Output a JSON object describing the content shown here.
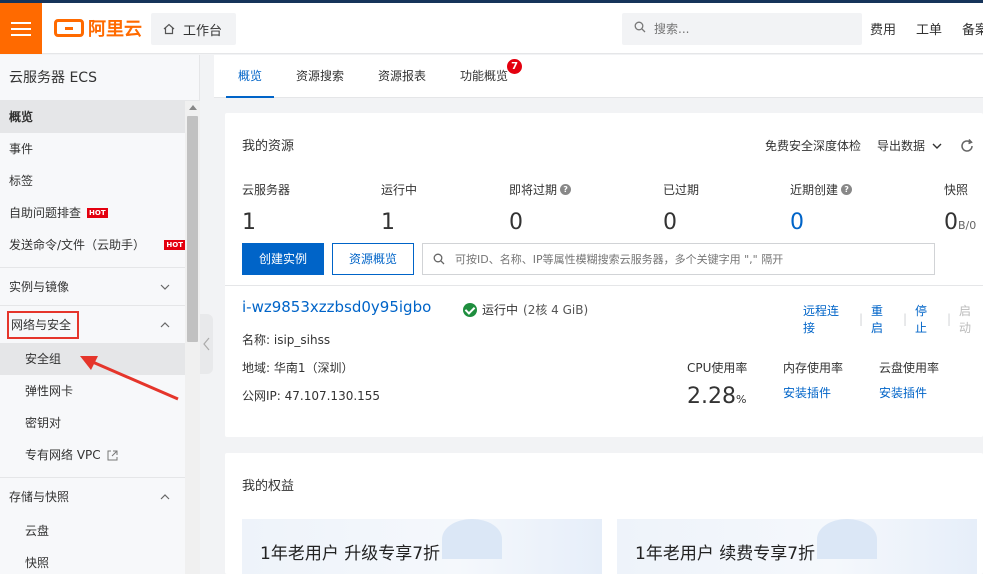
{
  "topbar": {
    "brand": "阿里云",
    "workbench": "工作台",
    "search_placeholder": "搜索...",
    "links": [
      "费用",
      "工单",
      "备案"
    ]
  },
  "sidebar": {
    "title": "云服务器 ECS",
    "items": [
      {
        "label": "概览",
        "active": true
      },
      {
        "label": "事件"
      },
      {
        "label": "标签"
      },
      {
        "label": "自助问题排查",
        "hot": "HOT"
      },
      {
        "label": "发送命令/文件（云助手）",
        "hot": "HOT"
      }
    ],
    "groups": [
      {
        "label": "实例与镜像",
        "expanded": false
      },
      {
        "label": "网络与安全",
        "expanded": true,
        "children": [
          "安全组",
          "弹性网卡",
          "密钥对",
          "专有网络 VPC"
        ]
      },
      {
        "label": "存储与快照",
        "expanded": true,
        "children": [
          "云盘",
          "快照"
        ]
      }
    ]
  },
  "tabs": [
    {
      "label": "概览",
      "active": true
    },
    {
      "label": "资源搜索"
    },
    {
      "label": "资源报表"
    },
    {
      "label": "功能概览",
      "badge": "7"
    }
  ],
  "resources": {
    "title": "我的资源",
    "actions": {
      "trial": "免费安全深度体检",
      "export": "导出数据"
    },
    "stats": [
      {
        "label": "云服务器",
        "value": "1"
      },
      {
        "label": "运行中",
        "value": "1"
      },
      {
        "label": "即将过期",
        "value": "0"
      },
      {
        "label": "已过期",
        "value": "0"
      },
      {
        "label": "近期创建",
        "value": "0"
      },
      {
        "label": "快照",
        "value": "0",
        "unit": "B/0"
      }
    ],
    "create_button": "创建实例",
    "overview_button": "资源概览",
    "search_placeholder": "可按ID、名称、IP等属性模糊搜索云服务器，多个关键字用 \",\" 隔开",
    "instance": {
      "id": "i-wz9853xzzbsd0y95igbo",
      "status": "运行中",
      "spec": "(2核 4 GiB)",
      "actions": [
        "远程连接",
        "重启",
        "停止",
        "启动"
      ],
      "name": "名称: isip_sihss",
      "region": "地域: 华南1（深圳）",
      "public_ip": "公网IP: 47.107.130.155",
      "cpu_label": "CPU使用率",
      "cpu_value": "2.28",
      "cpu_unit": "%",
      "mem_label": "内存使用率",
      "disk_label": "云盘使用率",
      "install_plugin": "安装插件"
    }
  },
  "rights": {
    "title": "我的权益",
    "promos": [
      "1年老用户 升级专享7折",
      "1年老用户 续费专享7折"
    ]
  },
  "colors": {
    "brand": "#ff6a00",
    "primary": "#0064c8",
    "annotation": "#e5352b"
  }
}
